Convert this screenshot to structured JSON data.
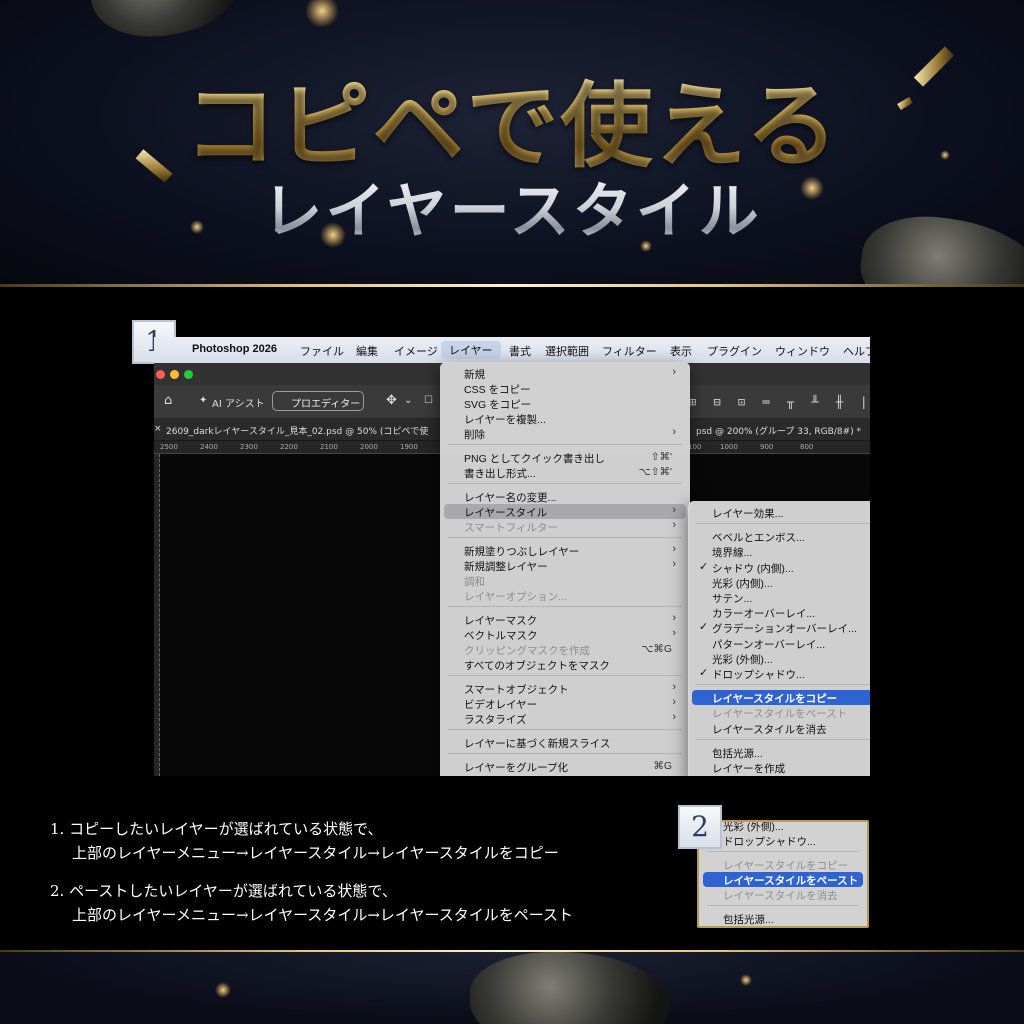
{
  "title": {
    "line1": "コピペで使える",
    "line2": "レイヤースタイル"
  },
  "badges": {
    "step1": "1",
    "step2": "2"
  },
  "menubar": {
    "app": "Photoshop 2026",
    "items": [
      "ファイル",
      "編集",
      "イメージ",
      "レイヤー",
      "書式",
      "選択範囲",
      "フィルター",
      "表示",
      "プラグイン",
      "ウィンドウ",
      "ヘルプ"
    ],
    "active": "レイヤー"
  },
  "options_bar": {
    "home_icon": "home-icon",
    "ai_assist": "AI アシスト",
    "pro_editor": "プロエディター",
    "align_icons": "⊞ ⊟ ⊡ ═ ╥ ╨ ╫ |"
  },
  "tabs": {
    "left": "2609_darkレイヤースタイル_見本_02.psd @ 50% (コピペで使",
    "right": "psd @ 200% (グループ 33, RGB/8#) *"
  },
  "ruler": {
    "left": [
      "2500",
      "2400",
      "2300",
      "2200",
      "2100",
      "2000",
      "1900"
    ],
    "right": [
      "100",
      "1000",
      "900",
      "800"
    ]
  },
  "layer_menu": [
    {
      "label": "新規",
      "arrow": true
    },
    {
      "label": "CSS をコピー"
    },
    {
      "label": "SVG をコピー"
    },
    {
      "label": "レイヤーを複製..."
    },
    {
      "label": "削除",
      "arrow": true
    },
    {
      "label": "PNG としてクイック書き出し",
      "shortcut": "⇧⌘'"
    },
    {
      "label": "書き出し形式...",
      "shortcut": "⌥⇧⌘'"
    },
    {
      "label": "レイヤー名の変更..."
    },
    {
      "label": "レイヤースタイル",
      "arrow": true,
      "highlight": true
    },
    {
      "label": "スマートフィルター",
      "arrow": true,
      "disabled": true
    },
    {
      "label": "新規塗りつぶしレイヤー",
      "arrow": true
    },
    {
      "label": "新規調整レイヤー",
      "arrow": true
    },
    {
      "label": "調和",
      "disabled": true
    },
    {
      "label": "レイヤーオプション...",
      "disabled": true
    },
    {
      "label": "レイヤーマスク",
      "arrow": true
    },
    {
      "label": "ベクトルマスク",
      "arrow": true
    },
    {
      "label": "クリッピングマスクを作成",
      "shortcut": "⌥⌘G",
      "disabled": true
    },
    {
      "label": "すべてのオブジェクトをマスク"
    },
    {
      "label": "スマートオブジェクト",
      "arrow": true
    },
    {
      "label": "ビデオレイヤー",
      "arrow": true
    },
    {
      "label": "ラスタライズ",
      "arrow": true
    },
    {
      "label": "レイヤーに基づく新規スライス"
    },
    {
      "label": "レイヤーをグループ化",
      "shortcut": "⌘G"
    }
  ],
  "style_submenu": [
    {
      "label": "レイヤー効果..."
    },
    {
      "label": "ベベルとエンボス..."
    },
    {
      "label": "境界線..."
    },
    {
      "label": "シャドウ (内側)...",
      "checked": true
    },
    {
      "label": "光彩 (内側)..."
    },
    {
      "label": "サテン..."
    },
    {
      "label": "カラーオーバーレイ..."
    },
    {
      "label": "グラデーションオーバーレイ...",
      "checked": true
    },
    {
      "label": "パターンオーバーレイ..."
    },
    {
      "label": "光彩 (外側)..."
    },
    {
      "label": "ドロップシャドウ...",
      "checked": true
    },
    {
      "label": "レイヤースタイルをコピー",
      "highlight": true
    },
    {
      "label": "レイヤースタイルをペースト",
      "disabled": true
    },
    {
      "label": "レイヤースタイルを消去"
    },
    {
      "label": "包括光源..."
    },
    {
      "label": "レイヤーを作成"
    }
  ],
  "instructions": {
    "step1_a": "1. コピーしたいレイヤーが選ばれている状態で、",
    "step1_b": "上部のレイヤーメニュー→レイヤースタイル→レイヤースタイルをコピー",
    "step2_a": "2. ペーストしたいレイヤーが選ばれている状態で、",
    "step2_b": "上部のレイヤーメニュー→レイヤースタイル→レイヤースタイルをペースト"
  },
  "mini_menu": [
    {
      "label": "光彩 (外側)..."
    },
    {
      "label": "ドロップシャドウ...",
      "checked": true
    },
    {
      "label": "レイヤースタイルをコピー",
      "disabled": true
    },
    {
      "label": "レイヤースタイルをペースト",
      "highlight": true
    },
    {
      "label": "レイヤースタイルを消去",
      "disabled": true
    },
    {
      "label": "包括光源..."
    }
  ],
  "colors": {
    "gold": "#e3c77a",
    "highlight_blue": "#2f63d1",
    "menu_bg": "#d6d6d6"
  }
}
